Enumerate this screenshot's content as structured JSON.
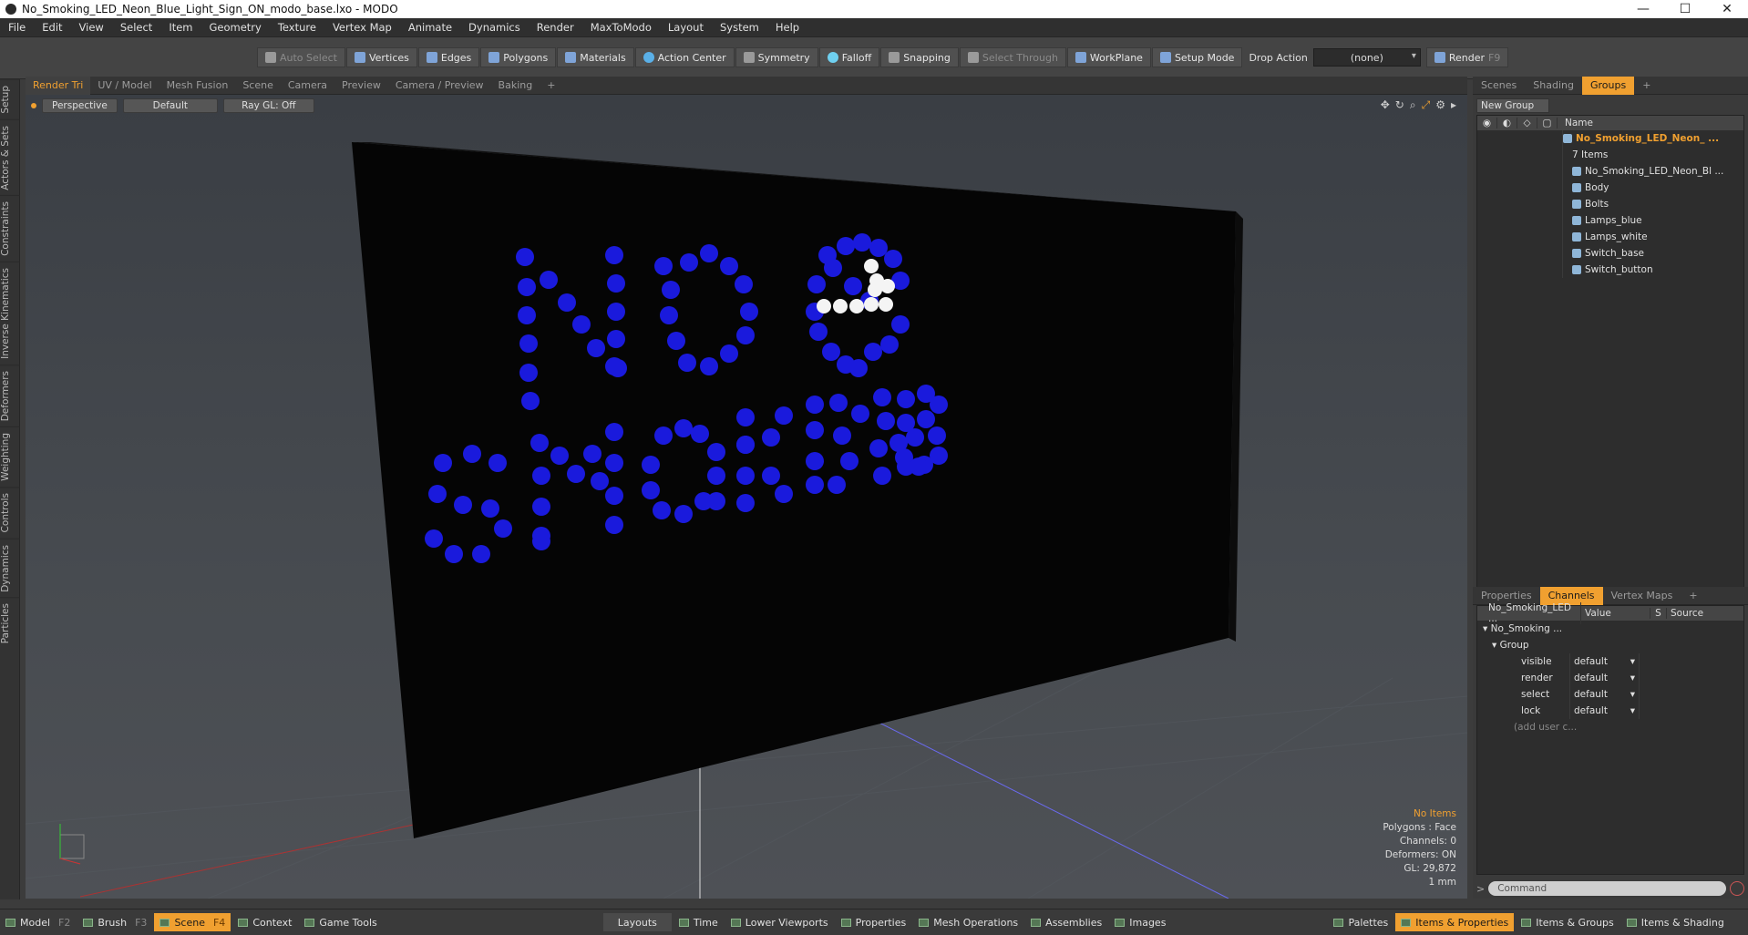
{
  "window": {
    "title": "No_Smoking_LED_Neon_Blue_Light_Sign_ON_modo_base.lxo - MODO",
    "minimize": "—",
    "maximize": "☐",
    "close": "✕"
  },
  "menu": [
    "File",
    "Edit",
    "View",
    "Select",
    "Item",
    "Geometry",
    "Texture",
    "Vertex Map",
    "Animate",
    "Dynamics",
    "Render",
    "MaxToModo",
    "Layout",
    "System",
    "Help"
  ],
  "toolbar": {
    "auto_select": "Auto Select",
    "vertices": "Vertices",
    "edges": "Edges",
    "polygons": "Polygons",
    "materials": "Materials",
    "action_center": "Action Center",
    "symmetry": "Symmetry",
    "falloff": "Falloff",
    "snapping": "Snapping",
    "select_through": "Select Through",
    "workplane": "WorkPlane",
    "setup_mode": "Setup Mode",
    "drop_action_label": "Drop Action",
    "drop_action_value": "(none)",
    "render": "Render",
    "render_key": "F9"
  },
  "left_tabs": [
    "Setup",
    "Actors & Sets",
    "Constraints",
    "Inverse Kinematics",
    "Deformers",
    "Weighting",
    "Controls",
    "Dynamics",
    "Particles"
  ],
  "viewport_tabs": [
    "Render Tri",
    "UV / Model",
    "Mesh Fusion",
    "Scene",
    "Camera",
    "Preview",
    "Camera / Preview",
    "Baking",
    "+"
  ],
  "viewport": {
    "view": "Perspective",
    "shading": "Default",
    "raygl": "Ray GL: Off"
  },
  "hud": {
    "items": "No Items",
    "polygons": "Polygons : Face",
    "channels": "Channels: 0",
    "deformers": "Deformers: ON",
    "gl": "GL: 29,872",
    "scale": "1 mm"
  },
  "right_tabs": [
    "Scenes",
    "Shading",
    "Groups",
    "+"
  ],
  "groups": {
    "new_group": "New Group",
    "name_col": "Name",
    "root": "No_Smoking_LED_Neon_ ...",
    "count": "7 Items",
    "items": [
      "No_Smoking_LED_Neon_Bl ...",
      "Body",
      "Bolts",
      "Lamps_blue",
      "Lamps_white",
      "Switch_base",
      "Switch_button"
    ]
  },
  "prop_tabs": [
    "Properties",
    "Channels",
    "Vertex Maps",
    "+"
  ],
  "channels": {
    "col_name": "No_Smoking_LED ...",
    "col_value": "Value",
    "col_s": "S",
    "col_source": "Source",
    "root": "No_Smoking ...",
    "group": "Group",
    "rows": [
      {
        "k": "visible",
        "v": "default"
      },
      {
        "k": "render",
        "v": "default"
      },
      {
        "k": "select",
        "v": "default"
      },
      {
        "k": "lock",
        "v": "default"
      }
    ],
    "add": "(add user c..."
  },
  "command": {
    "placeholder": "Command"
  },
  "bottom": {
    "model": "Model",
    "model_key": "F2",
    "brush": "Brush",
    "brush_key": "F3",
    "scene": "Scene",
    "scene_key": "F4",
    "context": "Context",
    "game_tools": "Game Tools",
    "layouts": "Layouts",
    "time": "Time",
    "lower_viewports": "Lower Viewports",
    "properties": "Properties",
    "mesh_operations": "Mesh Operations",
    "assemblies": "Assemblies",
    "images": "Images",
    "palettes": "Palettes",
    "items_props": "Items & Properties",
    "items_groups": "Items & Groups",
    "items_shading": "Items & Shading"
  },
  "colors": {
    "accent": "#f0a030",
    "led_blue": "#1a1adc",
    "led_white": "#f4f4f4",
    "sign": "#050505"
  }
}
